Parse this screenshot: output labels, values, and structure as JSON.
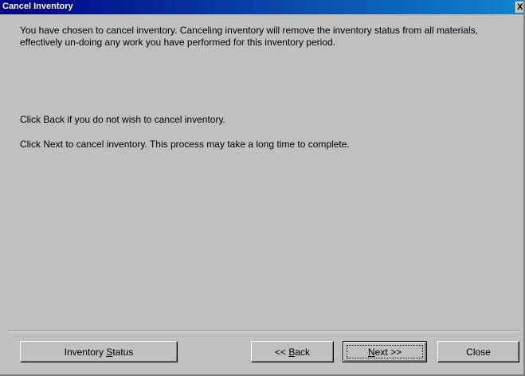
{
  "window": {
    "title": "Cancel Inventory",
    "close_glyph": "X"
  },
  "message": {
    "intro": "You have chosen to cancel inventory.  Canceling inventory will remove the inventory status from all materials, effectively un-doing any work you have performed for this inventory period.",
    "back_hint": "Click Back if you do not wish to cancel inventory.",
    "next_hint": "Click Next to cancel inventory.  This process may take a long time to complete."
  },
  "buttons": {
    "inventory_status": {
      "pre": "Inventory ",
      "mnemonic": "S",
      "post": "tatus"
    },
    "back": {
      "pre": "<< ",
      "mnemonic": "B",
      "post": "ack"
    },
    "next": {
      "pre": "",
      "mnemonic": "N",
      "post": "ext >>"
    },
    "close": "Close"
  },
  "colors": {
    "titlebar_start": "#000080",
    "titlebar_end": "#1084d0",
    "face": "#c0c0c0"
  }
}
